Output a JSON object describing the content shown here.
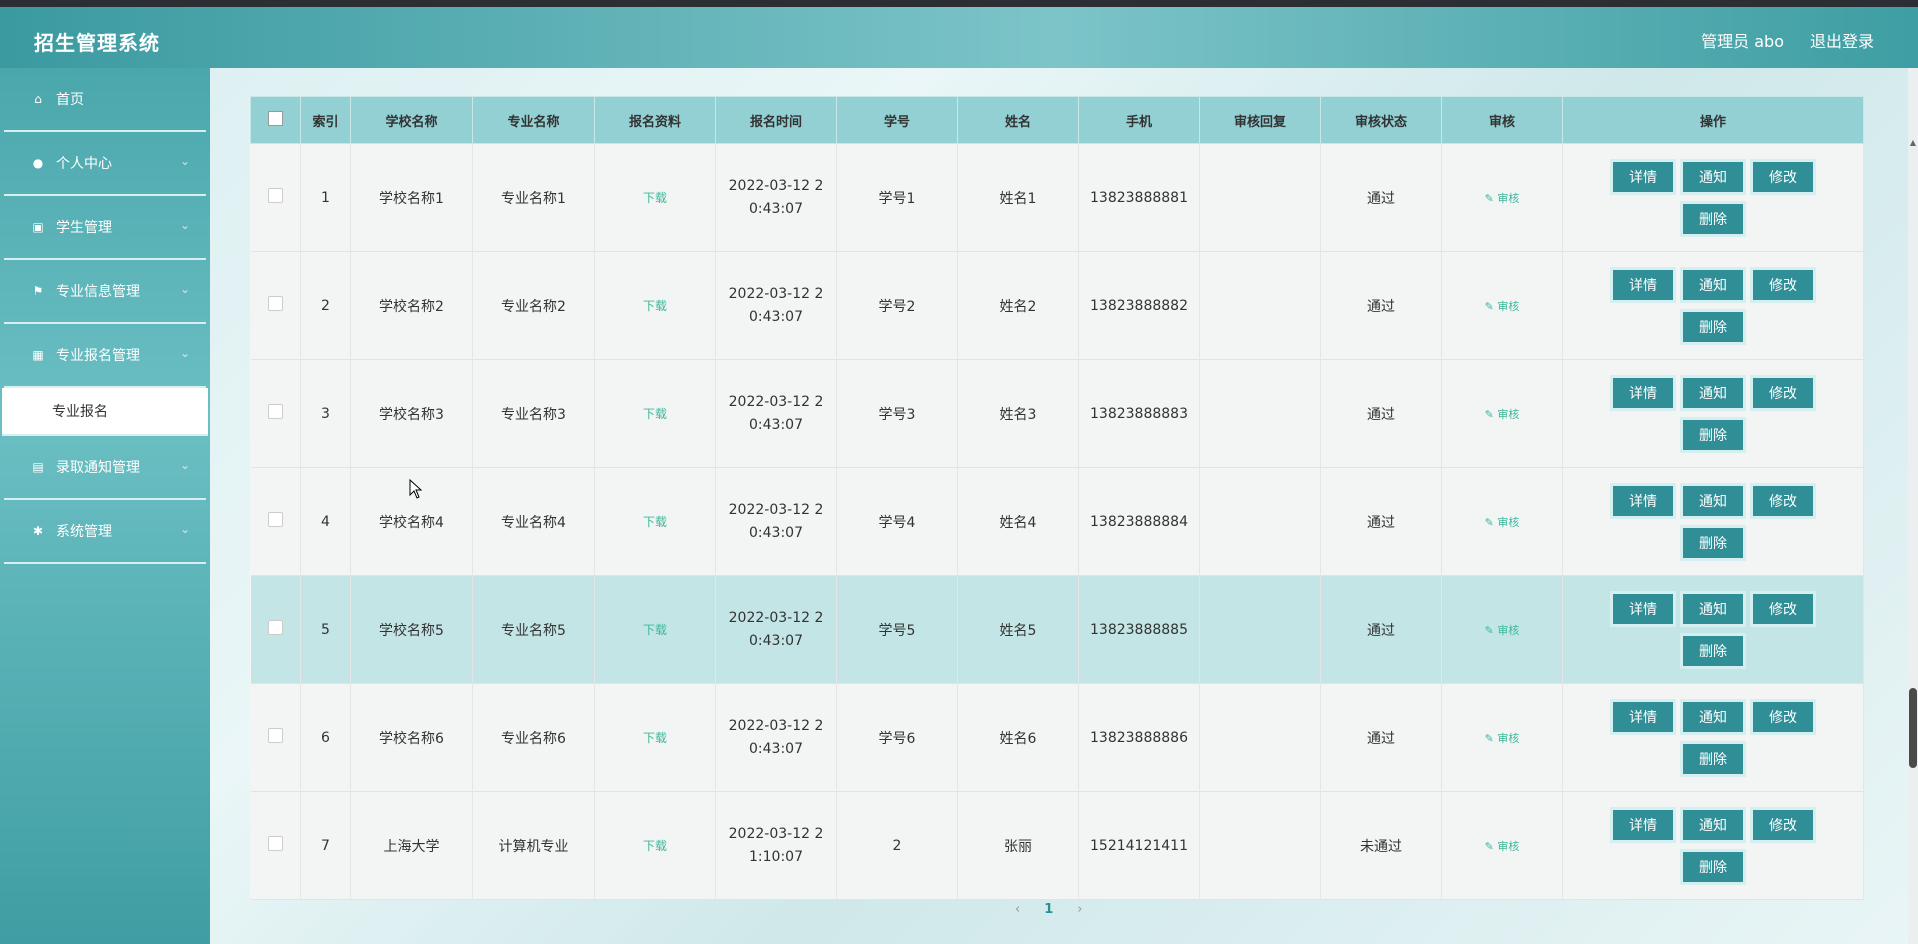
{
  "app": {
    "title": "招生管理系统",
    "user_label": "管理员 abo",
    "logout_label": "退出登录"
  },
  "sidebar": {
    "items": [
      {
        "label": "首页",
        "icon": "home-icon"
      },
      {
        "label": "个人中心",
        "icon": "user-icon"
      },
      {
        "label": "学生管理",
        "icon": "clipboard-icon"
      },
      {
        "label": "专业信息管理",
        "icon": "flag-icon"
      },
      {
        "label": "专业报名管理",
        "icon": "grid-icon",
        "sub": "专业报名"
      },
      {
        "label": "录取通知管理",
        "icon": "notice-icon"
      },
      {
        "label": "系统管理",
        "icon": "settings-icon"
      }
    ]
  },
  "table": {
    "headers": [
      "索引",
      "学校名称",
      "专业名称",
      "报名资料",
      "报名时间",
      "学号",
      "姓名",
      "手机",
      "审核回复",
      "审核状态",
      "审核",
      "操作"
    ],
    "download_label": "下载",
    "review_label": "审核",
    "buttons": {
      "detail": "详情",
      "notify": "通知",
      "edit": "修改",
      "delete": "删除"
    },
    "rows": [
      {
        "index": "1",
        "school": "学校名称1",
        "major": "专业名称1",
        "time1": "2022-03-12 2",
        "time2": "0:43:07",
        "sid": "学号1",
        "name": "姓名1",
        "phone": "13823888881",
        "reply": "",
        "status": "通过"
      },
      {
        "index": "2",
        "school": "学校名称2",
        "major": "专业名称2",
        "time1": "2022-03-12 2",
        "time2": "0:43:07",
        "sid": "学号2",
        "name": "姓名2",
        "phone": "13823888882",
        "reply": "",
        "status": "通过"
      },
      {
        "index": "3",
        "school": "学校名称3",
        "major": "专业名称3",
        "time1": "2022-03-12 2",
        "time2": "0:43:07",
        "sid": "学号3",
        "name": "姓名3",
        "phone": "13823888883",
        "reply": "",
        "status": "通过"
      },
      {
        "index": "4",
        "school": "学校名称4",
        "major": "专业名称4",
        "time1": "2022-03-12 2",
        "time2": "0:43:07",
        "sid": "学号4",
        "name": "姓名4",
        "phone": "13823888884",
        "reply": "",
        "status": "通过"
      },
      {
        "index": "5",
        "school": "学校名称5",
        "major": "专业名称5",
        "time1": "2022-03-12 2",
        "time2": "0:43:07",
        "sid": "学号5",
        "name": "姓名5",
        "phone": "13823888885",
        "reply": "",
        "status": "通过"
      },
      {
        "index": "6",
        "school": "学校名称6",
        "major": "专业名称6",
        "time1": "2022-03-12 2",
        "time2": "0:43:07",
        "sid": "学号6",
        "name": "姓名6",
        "phone": "13823888886",
        "reply": "",
        "status": "通过"
      },
      {
        "index": "7",
        "school": "上海大学",
        "major": "计算机专业",
        "time1": "2022-03-12 2",
        "time2": "1:10:07",
        "sid": "2",
        "name": "张丽",
        "phone": "15214121411",
        "reply": "",
        "status": "未通过"
      }
    ]
  },
  "pager": {
    "prev": "‹",
    "page": "1",
    "next": "›"
  },
  "colors": {
    "accent": "#2f8e96",
    "header_bg": "#92d0d4",
    "link": "#3db89b"
  }
}
